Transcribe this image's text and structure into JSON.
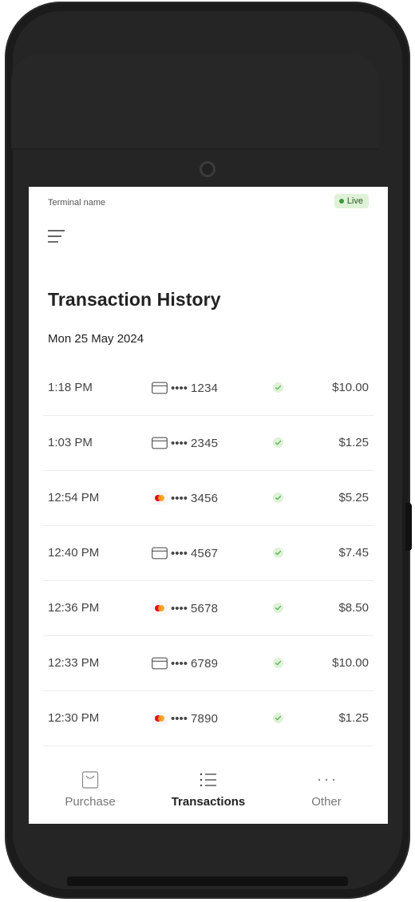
{
  "header": {
    "terminal_name": "Terminal name",
    "status_label": "Live"
  },
  "main": {
    "title": "Transaction History",
    "date": "Mon 25 May 2024"
  },
  "transactions": [
    {
      "time": "1:18 PM",
      "card_type": "card",
      "card_dots": "••••",
      "card_last4": "1234",
      "status": "success",
      "amount": "$10.00"
    },
    {
      "time": "1:03 PM",
      "card_type": "card",
      "card_dots": "••••",
      "card_last4": "2345",
      "status": "success",
      "amount": "$1.25"
    },
    {
      "time": "12:54 PM",
      "card_type": "mastercard",
      "card_dots": "••••",
      "card_last4": "3456",
      "status": "success",
      "amount": "$5.25"
    },
    {
      "time": "12:40 PM",
      "card_type": "card",
      "card_dots": "••••",
      "card_last4": "4567",
      "status": "success",
      "amount": "$7.45"
    },
    {
      "time": "12:36 PM",
      "card_type": "mastercard",
      "card_dots": "••••",
      "card_last4": "5678",
      "status": "success",
      "amount": "$8.50"
    },
    {
      "time": "12:33 PM",
      "card_type": "card",
      "card_dots": "••••",
      "card_last4": "6789",
      "status": "success",
      "amount": "$10.00"
    },
    {
      "time": "12:30 PM",
      "card_type": "mastercard",
      "card_dots": "••••",
      "card_last4": "7890",
      "status": "success",
      "amount": "$1.25"
    }
  ],
  "nav": {
    "purchase": "Purchase",
    "transactions": "Transactions",
    "other": "Other",
    "active": "transactions"
  },
  "colors": {
    "live_bg": "#dff2d8",
    "live_dot": "#3a9a3a",
    "check": "#5cb85c",
    "mastercard_red": "#eb001b",
    "mastercard_orange": "#f79e1b"
  }
}
